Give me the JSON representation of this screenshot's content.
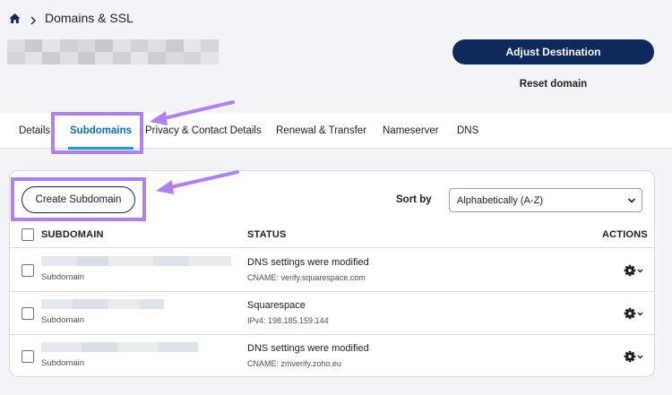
{
  "breadcrumb": {
    "home_icon": "home-icon",
    "current": "Domains & SSL"
  },
  "header": {
    "adjust_destination_label": "Adjust Destination",
    "reset_domain_label": "Reset domain"
  },
  "tabs": [
    {
      "label": "Details",
      "active": false
    },
    {
      "label": "Subdomains",
      "active": true
    },
    {
      "label": "Privacy & Contact Details",
      "active": false
    },
    {
      "label": "Renewal & Transfer",
      "active": false
    },
    {
      "label": "Nameserver",
      "active": false
    },
    {
      "label": "DNS",
      "active": false
    }
  ],
  "subdomains": {
    "create_label": "Create Subdomain",
    "sort_label": "Sort by",
    "sort_value": "Alphabetically (A-Z)",
    "columns": {
      "subdomain": "SUBDOMAIN",
      "status": "STATUS",
      "actions": "ACTIONS"
    },
    "rows": [
      {
        "type": "Subdomain",
        "status": "DNS settings were modified",
        "record": "CNAME: verify.squarespace.com"
      },
      {
        "type": "Subdomain",
        "status": "Squarespace",
        "record": "IPv4: 198.185.159.144"
      },
      {
        "type": "Subdomain",
        "status": "DNS settings were modified",
        "record": "CNAME: zmverify.zoho.eu"
      }
    ]
  },
  "colors": {
    "primary": "#0e2a5c",
    "accent": "#1aa0d8",
    "annotation": "#b07ff0"
  }
}
